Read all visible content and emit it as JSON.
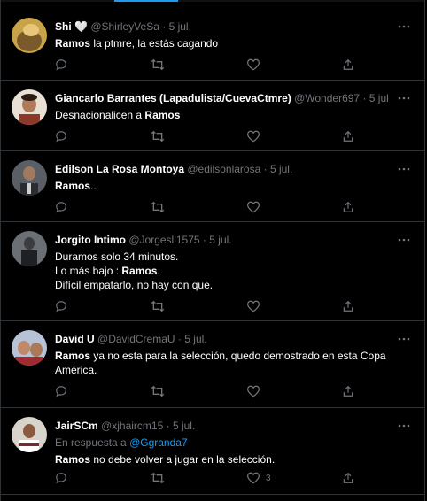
{
  "tweets": [
    {
      "name": "Shi",
      "name_emoji": "🤍",
      "handle": "@ShirleyVeSa",
      "sep": "·",
      "date": "5 jul.",
      "bold": "Ramos",
      "text": " la ptmre, la estás cagando",
      "avatar_colors": [
        "#c9a34a",
        "#7a5a2a"
      ]
    },
    {
      "name": "Giancarlo Barrantes (Lapadulista/CuevaCtmre)",
      "handle": "@Wonder697",
      "sep": "·",
      "date": "5 jul.",
      "pre": "Desnacionalicen a ",
      "bold": "Ramos",
      "avatar_colors": [
        "#e8e0d4",
        "#8b3a2a"
      ]
    },
    {
      "name": "Edilson La Rosa Montoya",
      "handle": "@edilsonlarosa",
      "sep": "·",
      "date": "5 jul.",
      "bold": "Ramos",
      "text": "..",
      "avatar_colors": [
        "#5a5f66",
        "#2a2c30"
      ]
    },
    {
      "name": "Jorgito Intimo",
      "handle": "@Jorgesll1575",
      "sep": "·",
      "date": "5 jul.",
      "line1": "Duramos solo 34 minutos.",
      "line2_pre": "Lo más bajo : ",
      "line2_bold": "Ramos",
      "line2_post": ".",
      "line3": "Difícil empatarlo, no hay con que.",
      "avatar_colors": [
        "#6a6f75",
        "#1e2024"
      ]
    },
    {
      "name": "David U",
      "handle": "@DavidCremaU",
      "sep": "·",
      "date": "5 jul.",
      "bold": "Ramos",
      "text": " ya no esta para la selección,  quedo demostrado en esta Copa América.",
      "avatar_colors": [
        "#b8c2d6",
        "#a02a32"
      ]
    },
    {
      "name": "JairSCm",
      "handle": "@xjhaircm15",
      "sep": "·",
      "date": "5 jul.",
      "reply_label": "En respuesta a ",
      "reply_handle": "@Ggranda7",
      "bold": "Ramos",
      "text": " no debe volver a jugar en la selección.",
      "like_count": "3",
      "avatar_colors": [
        "#d8d4cc",
        "#7a2a2a"
      ]
    }
  ],
  "icons": [
    "reply-icon",
    "retweet-icon",
    "like-icon",
    "share-icon",
    "more-icon"
  ],
  "colors": {
    "background": "#000000",
    "text": "#ffffff",
    "muted": "#71767b",
    "link": "#1d9bf0",
    "divider": "#2f3336"
  }
}
